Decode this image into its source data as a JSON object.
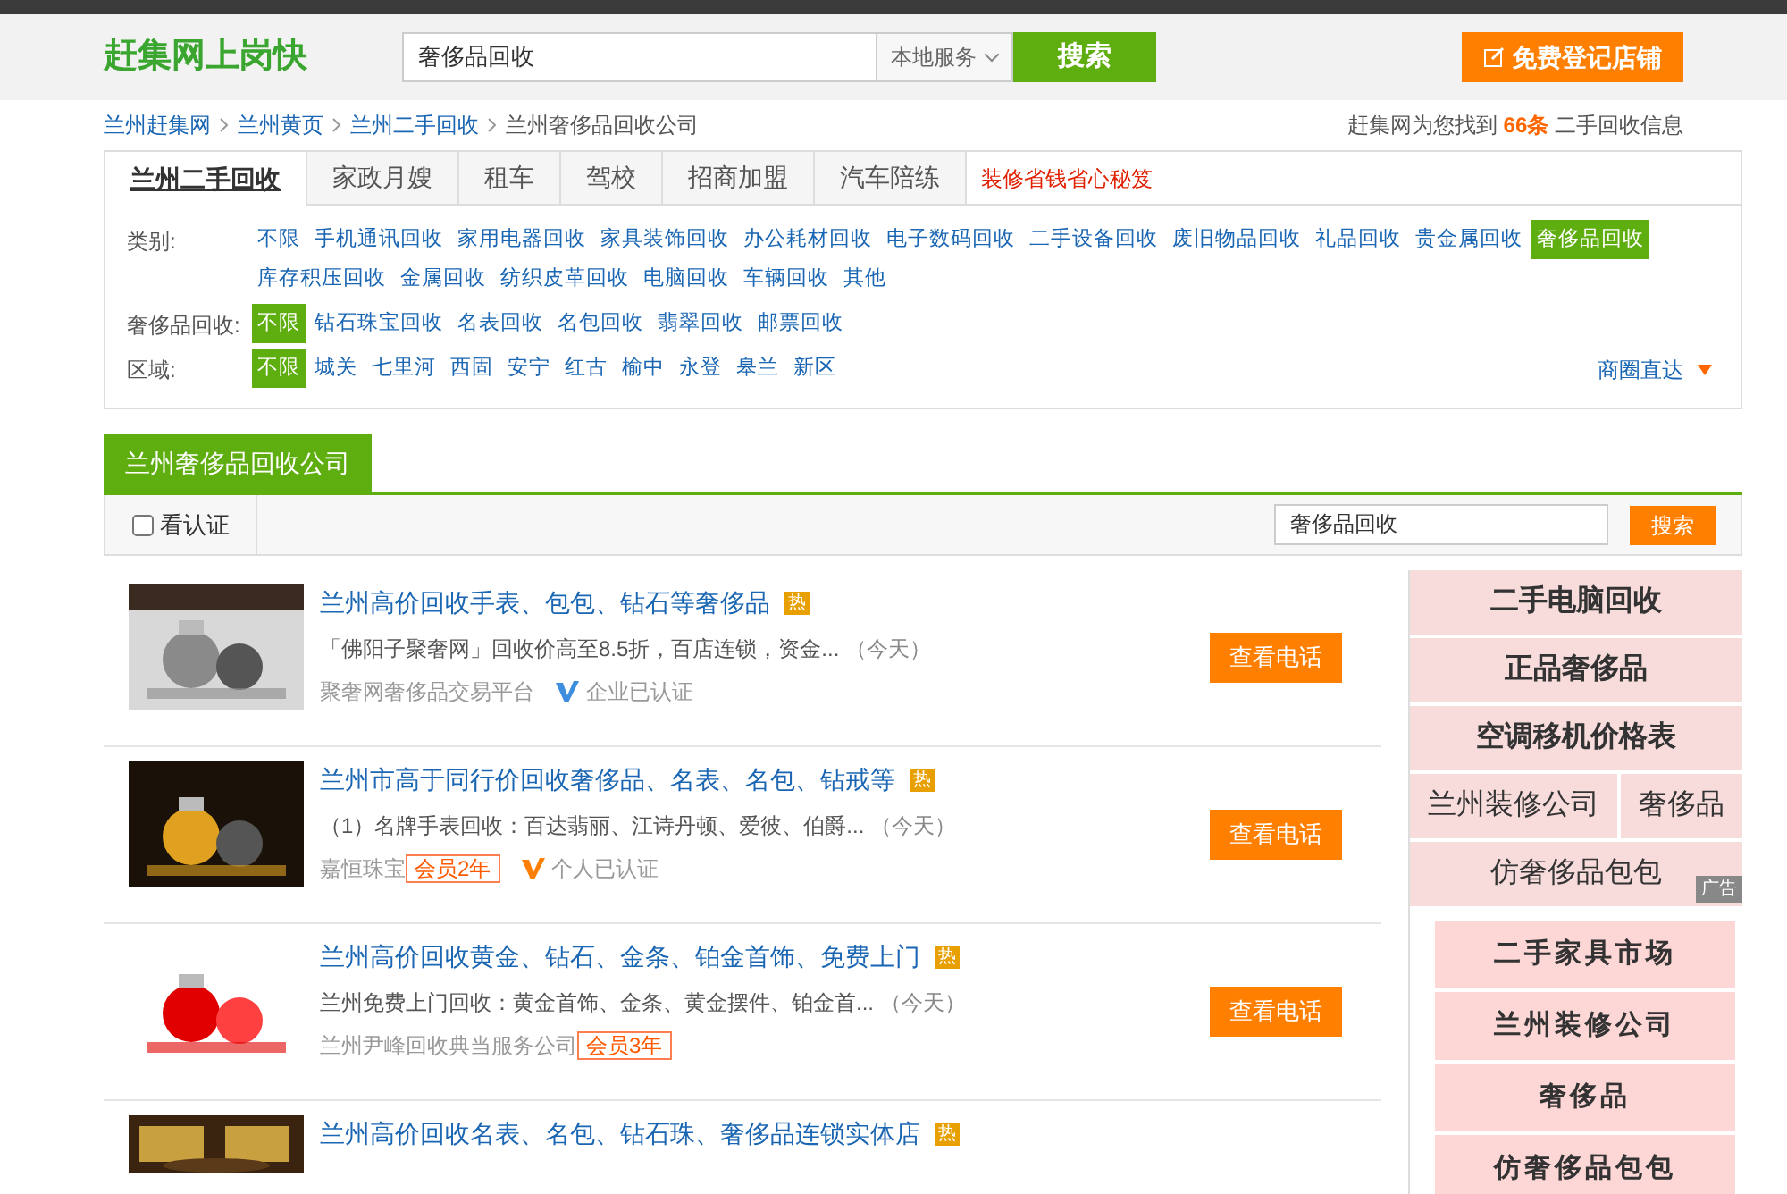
{
  "header": {
    "logo": "赶集网上岗快",
    "search_value": "奢侈品回收",
    "scope": "本地服务",
    "search_button": "搜索",
    "register_button": "免费登记店铺"
  },
  "breadcrumb": [
    "兰州赶集网",
    "兰州黄页",
    "兰州二手回收",
    "兰州奢侈品回收公司"
  ],
  "result_summary": {
    "prefix": "赶集网为您找到",
    "count": "66条",
    "suffix": "二手回收信息"
  },
  "tabs": [
    {
      "label": "兰州二手回收",
      "selected": true,
      "kind": "tab"
    },
    {
      "label": "家政月嫂",
      "selected": false,
      "kind": "tab"
    },
    {
      "label": "租车",
      "selected": false,
      "kind": "tab"
    },
    {
      "label": "驾校",
      "selected": false,
      "kind": "tab"
    },
    {
      "label": "招商加盟",
      "selected": false,
      "kind": "tab"
    },
    {
      "label": "汽车陪练",
      "selected": false,
      "kind": "tab"
    },
    {
      "label": "装修省钱省心秘笈",
      "selected": false,
      "kind": "promo"
    }
  ],
  "filters": [
    {
      "label": "类别:",
      "options": [
        {
          "label": "不限",
          "selected": false
        },
        {
          "label": "手机通讯回收",
          "selected": false
        },
        {
          "label": "家用电器回收",
          "selected": false
        },
        {
          "label": "家具装饰回收",
          "selected": false
        },
        {
          "label": "办公耗材回收",
          "selected": false
        },
        {
          "label": "电子数码回收",
          "selected": false
        },
        {
          "label": "二手设备回收",
          "selected": false
        },
        {
          "label": "废旧物品回收",
          "selected": false
        },
        {
          "label": "礼品回收",
          "selected": false
        },
        {
          "label": "贵金属回收",
          "selected": false
        },
        {
          "label": "奢侈品回收",
          "selected": true
        },
        {
          "label": "库存积压回收",
          "selected": false
        },
        {
          "label": "金属回收",
          "selected": false
        },
        {
          "label": "纺织皮革回收",
          "selected": false
        },
        {
          "label": "电脑回收",
          "selected": false
        },
        {
          "label": "车辆回收",
          "selected": false
        },
        {
          "label": "其他",
          "selected": false
        }
      ]
    },
    {
      "label": "奢侈品回收:",
      "options": [
        {
          "label": "不限",
          "selected": true
        },
        {
          "label": "钻石珠宝回收",
          "selected": false
        },
        {
          "label": "名表回收",
          "selected": false
        },
        {
          "label": "名包回收",
          "selected": false
        },
        {
          "label": "翡翠回收",
          "selected": false
        },
        {
          "label": "邮票回收",
          "selected": false
        }
      ]
    },
    {
      "label": "区域:",
      "options": [
        {
          "label": "不限",
          "selected": true
        },
        {
          "label": "城关",
          "selected": false
        },
        {
          "label": "七里河",
          "selected": false
        },
        {
          "label": "西固",
          "selected": false
        },
        {
          "label": "安宁",
          "selected": false
        },
        {
          "label": "红古",
          "selected": false
        },
        {
          "label": "榆中",
          "selected": false
        },
        {
          "label": "永登",
          "selected": false
        },
        {
          "label": "皋兰",
          "selected": false
        },
        {
          "label": "新区",
          "selected": false
        }
      ],
      "extra": "商圈直达"
    }
  ],
  "section_tab": "兰州奢侈品回收公司",
  "toolbar": {
    "verified_label": "看认证",
    "verified_checked": false,
    "search_value": "奢侈品回收",
    "search_button": "搜索"
  },
  "listings": [
    {
      "title": "兰州高价回收手表、包包、钻石等奢侈品",
      "hot": "热",
      "description": "「佛阳子聚奢网」回收价高至8.5折，百店连锁，资金...",
      "time": "（今天）",
      "company": "聚奢网奢侈品交易平台",
      "verification": {
        "text": "企业已认证",
        "color": "#3d8ede"
      },
      "button": "查看电话"
    },
    {
      "title": "兰州市高于同行价回收奢侈品、名表、名包、钻戒等",
      "hot": "热",
      "description": "（1）名牌手表回收：百达翡丽、江诗丹顿、爱彼、伯爵...",
      "time": "（今天）",
      "company": "嘉恒珠宝",
      "member": "会员2年",
      "verification": {
        "text": "个人已认证",
        "color": "#ff7f00"
      },
      "button": "查看电话"
    },
    {
      "title": "兰州高价回收黄金、钻石、金条、铂金首饰、免费上门",
      "hot": "热",
      "description": "兰州免费上门回收：黄金首饰、金条、黄金摆件、铂金首...",
      "time": "（今天）",
      "company": "兰州尹峰回收典当服务公司",
      "member": "会员3年",
      "button": "查看电话"
    },
    {
      "title": "兰州高价回收名表、名包、钻石珠、奢侈品连锁实体店",
      "hot": "热"
    }
  ],
  "sidebar_ads": [
    {
      "rows": [
        [
          "二手电脑回收"
        ],
        [
          "正品奢侈品"
        ],
        [
          "空调移机价格表"
        ],
        [
          "兰州装修公司",
          "奢侈品"
        ],
        [
          "仿奢侈品包包"
        ]
      ],
      "badge": "广告"
    }
  ],
  "sidebar_links": [
    "二手家具市场",
    "兰州装修公司",
    "奢侈品",
    "仿奢侈品包包"
  ]
}
